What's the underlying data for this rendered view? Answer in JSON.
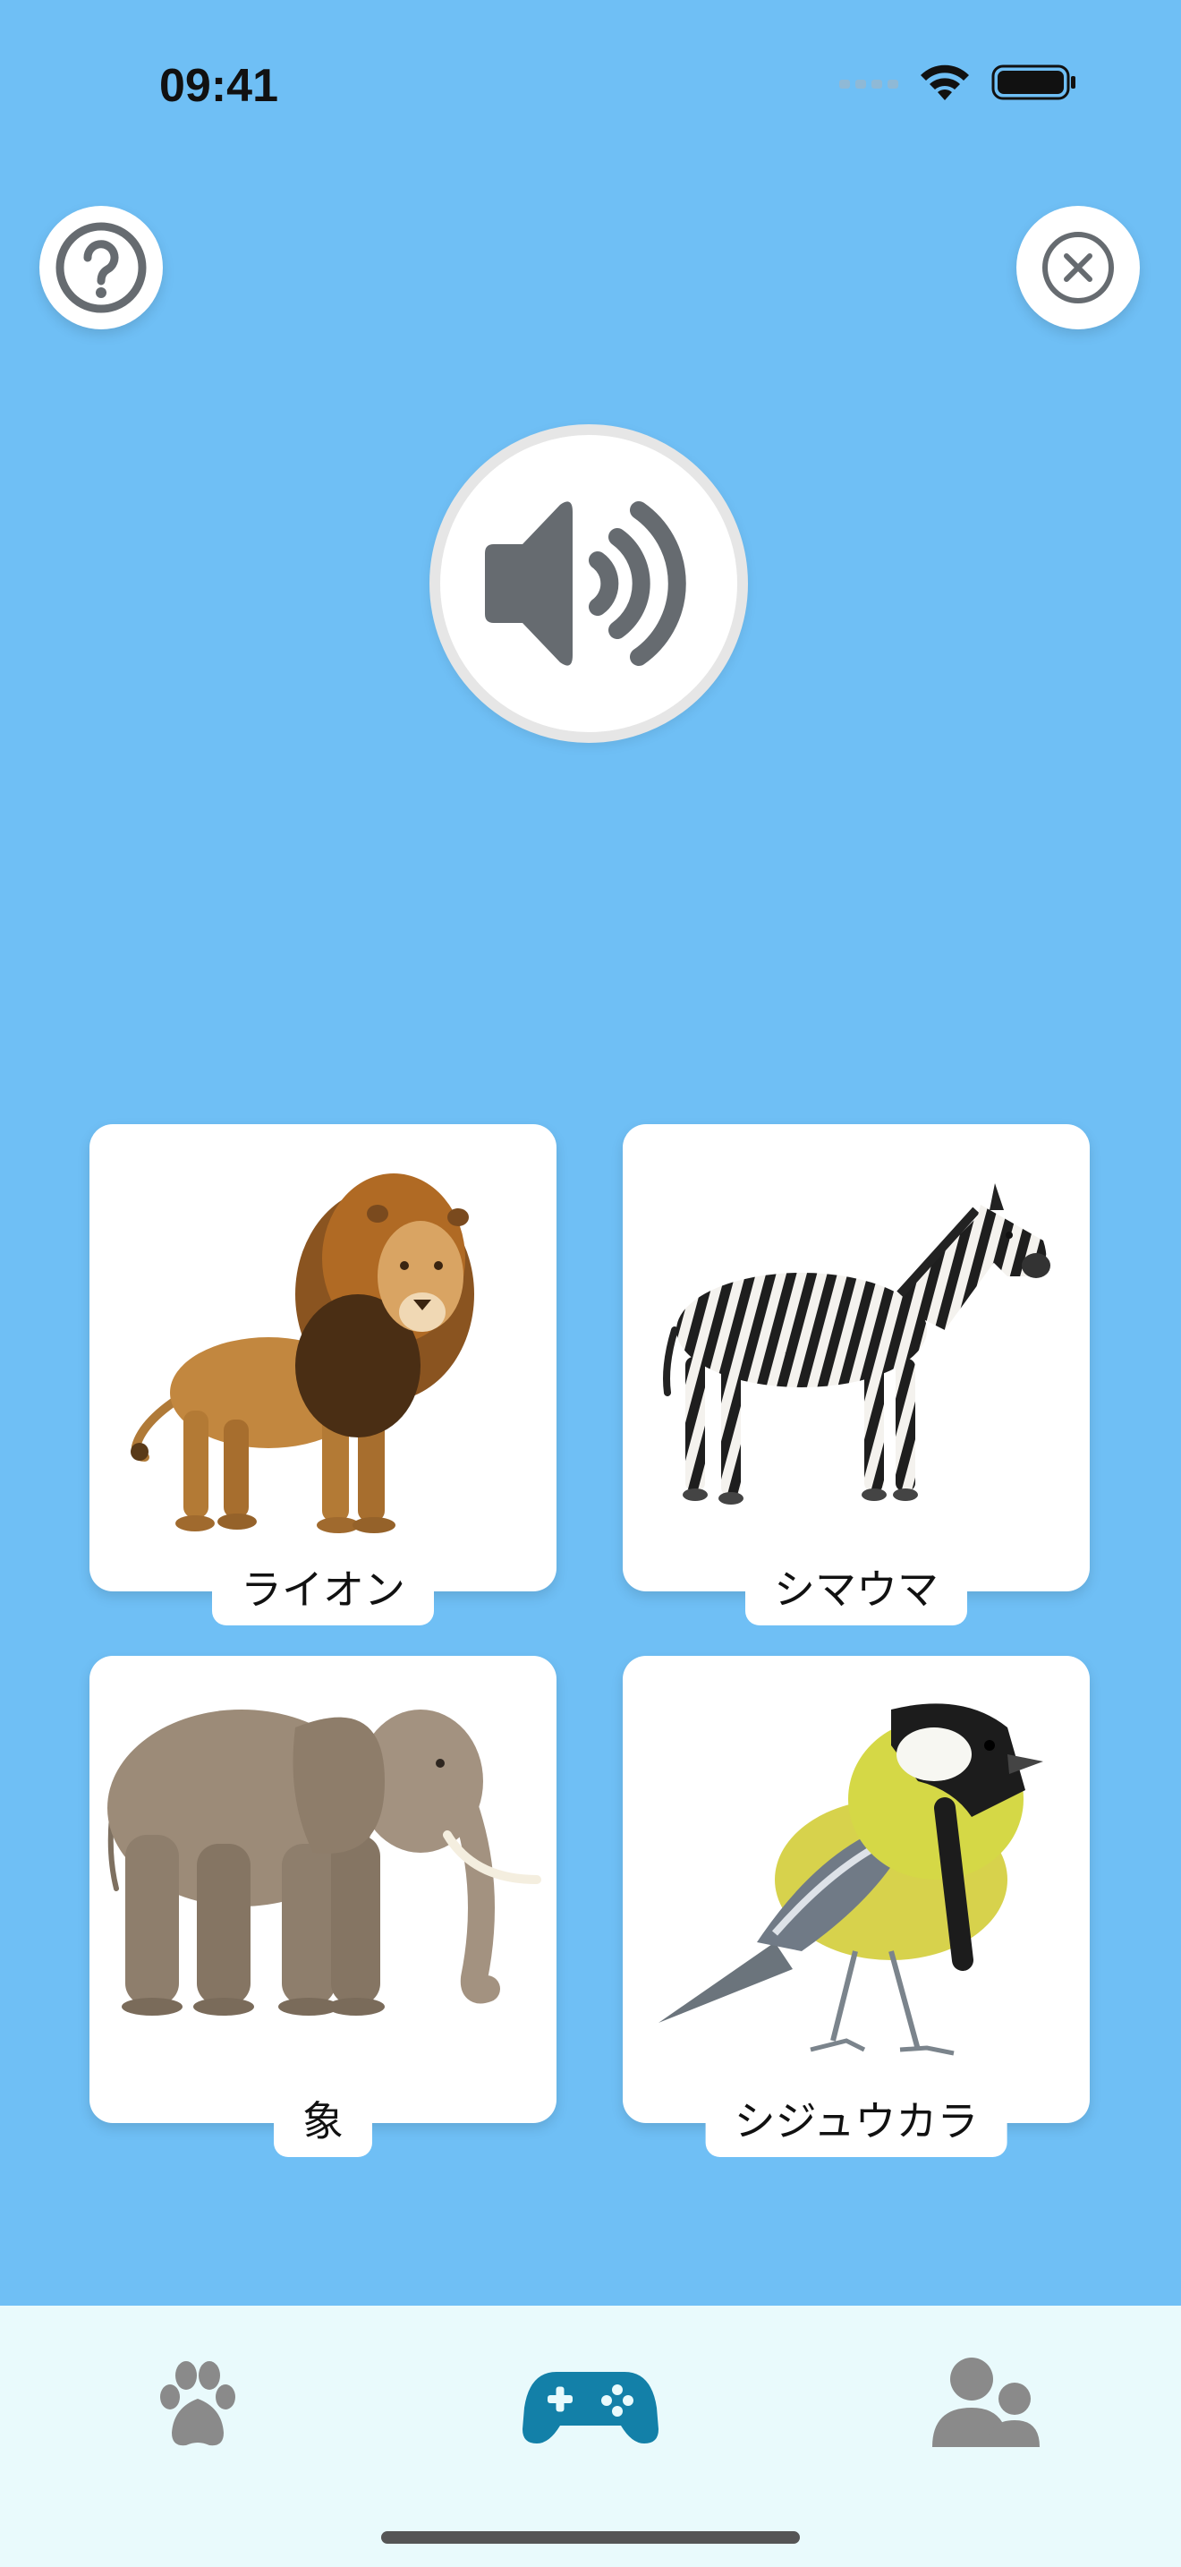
{
  "status_bar": {
    "time": "09:41"
  },
  "header": {
    "help_icon": "question-circle-icon",
    "close_icon": "x-circle-icon"
  },
  "sound_button": {
    "icon": "speaker-wave-icon"
  },
  "cards": [
    {
      "label": "ライオン",
      "image": "lion"
    },
    {
      "label": "シマウマ",
      "image": "zebra"
    },
    {
      "label": "象",
      "image": "elephant"
    },
    {
      "label": "シジュウカラ",
      "image": "great-tit-bird"
    }
  ],
  "tabbar": {
    "tabs": [
      {
        "icon": "paw-icon",
        "active": false
      },
      {
        "icon": "gamepad-icon",
        "active": true
      },
      {
        "icon": "users-icon",
        "active": false
      }
    ],
    "active_color": "#1380A8",
    "inactive_color": "#8A8A8A"
  },
  "colors": {
    "background": "#6FBFF5",
    "card": "#FFFFFF"
  }
}
